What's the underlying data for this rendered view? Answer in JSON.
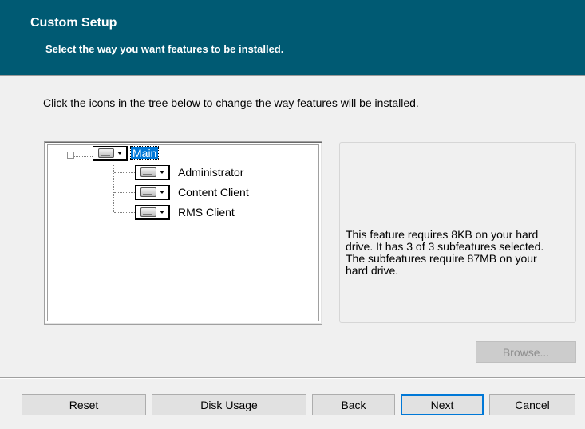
{
  "banner": {
    "title": "Custom Setup",
    "subtitle": "Select the way you want features to be installed.",
    "background_color": "#005a73"
  },
  "instruction": "Click the icons in the tree below to change the way features will be installed.",
  "tree": {
    "root": {
      "label": "Main",
      "icon": "hard-drive-icon",
      "selected": true,
      "expanded": true
    },
    "children": [
      {
        "label": "Administrator",
        "icon": "hard-drive-icon"
      },
      {
        "label": "Content Client",
        "icon": "hard-drive-icon"
      },
      {
        "label": "RMS Client",
        "icon": "hard-drive-icon"
      }
    ]
  },
  "description": "This feature requires 8KB on your hard drive. It has 3 of 3 subfeatures selected. The subfeatures require 87MB on your hard drive.",
  "buttons": {
    "browse": "Browse...",
    "reset": "Reset",
    "disk_usage": "Disk Usage",
    "back": "Back",
    "next": "Next",
    "cancel": "Cancel"
  },
  "colors": {
    "selection": "#0078d7",
    "default_button_border": "#0078d7"
  }
}
